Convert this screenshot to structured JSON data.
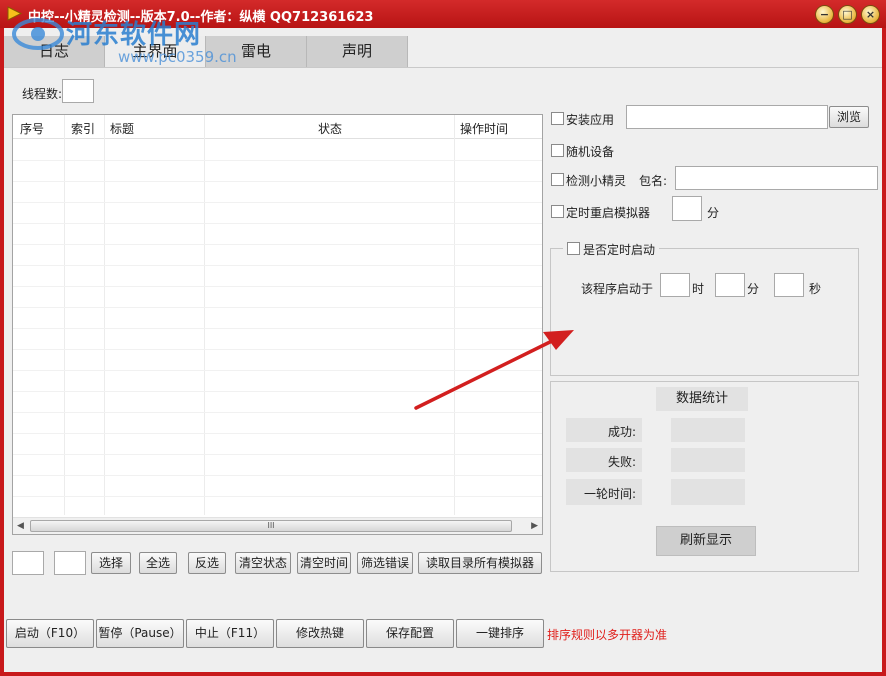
{
  "window": {
    "title": "中控--小精灵检测--版本7.0--作者：纵横 QQ712361623",
    "watermark_text": "河东软件网",
    "watermark_url": "www.pc0359.cn",
    "controls": [
      "minimize-icon",
      "maximize-icon",
      "close-icon"
    ]
  },
  "tabs": [
    {
      "label": "日志"
    },
    {
      "label": "主界面"
    },
    {
      "label": "雷电"
    },
    {
      "label": "声明"
    }
  ],
  "thread_count": {
    "label": "线程数:",
    "value": ""
  },
  "table": {
    "columns": [
      "序号",
      "索引",
      "标题",
      "状态",
      "操作时间"
    ],
    "rows": [],
    "scroll_grip": "III"
  },
  "list_actions": {
    "field1": "",
    "field2": "",
    "buttons": [
      "选择",
      "全选",
      "反选",
      "清空状态",
      "清空时间",
      "筛选错误",
      "读取目录所有模拟器"
    ]
  },
  "options": {
    "install_app": {
      "label": "安装应用",
      "checked": false,
      "path": ""
    },
    "browse_button": "浏览",
    "random_device": {
      "label": "随机设备",
      "checked": false
    },
    "detect_sprite": {
      "label": "检测小精灵",
      "checked": false
    },
    "package_label": "包名:",
    "package_value": "",
    "timed_restart": {
      "label": "定时重启模拟器",
      "checked": false,
      "minutes": ""
    },
    "minute_unit": "分"
  },
  "scheduled_start": {
    "label": "是否定时启动",
    "checked": false,
    "starts_at_label": "该程序启动于",
    "hour": "",
    "hour_unit": "时",
    "minute": "",
    "minute_unit": "分",
    "second": "",
    "second_unit": "秒"
  },
  "stats": {
    "title": "数据统计",
    "success_label": "成功:",
    "success_value": "",
    "fail_label": "失败:",
    "fail_value": "",
    "round_time_label": "一轮时间:",
    "round_time_value": "",
    "refresh_button": "刷新显示"
  },
  "bottom_buttons": [
    "启动（F10）",
    "暂停（Pause）",
    "中止（F11）",
    "修改热键",
    "保存配置",
    "一键排序"
  ],
  "bottom_note": "排序规则以多开器为准",
  "colors": {
    "title_bar": "#c8191b",
    "note_red": "#e0201c",
    "watermark_blue": "#2a7fd0",
    "annotation_arrow": "#d21f1f"
  }
}
